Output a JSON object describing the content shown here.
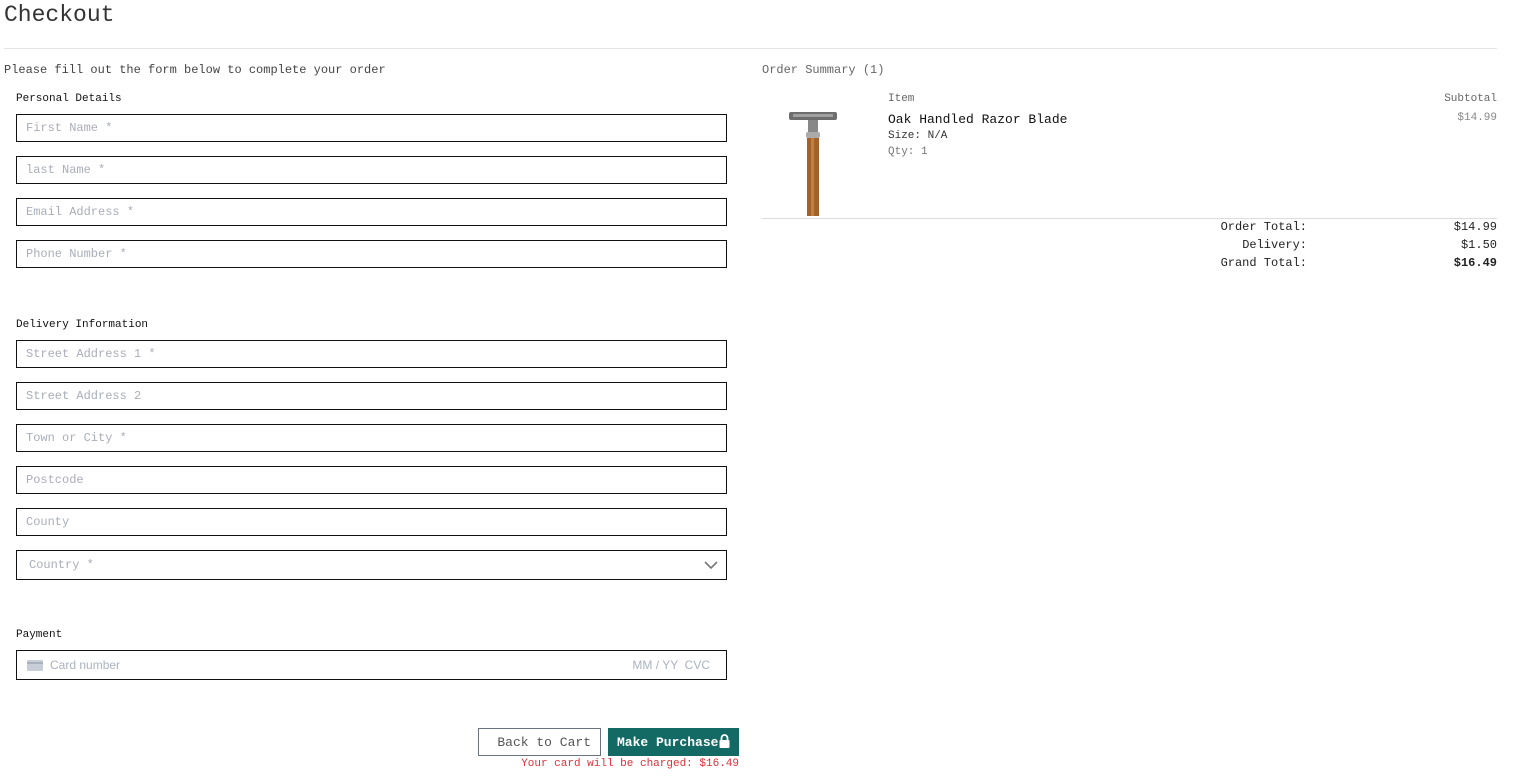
{
  "page": {
    "title": "Checkout",
    "intro": "Please fill out the form below to complete your order"
  },
  "personal": {
    "heading": "Personal Details",
    "fields": [
      {
        "placeholder": "First Name *",
        "value": ""
      },
      {
        "placeholder": "last Name *",
        "value": ""
      },
      {
        "placeholder": "Email Address *",
        "value": ""
      },
      {
        "placeholder": "Phone Number *",
        "value": ""
      }
    ]
  },
  "delivery": {
    "heading": "Delivery Information",
    "fields": [
      {
        "placeholder": "Street Address 1 *"
      },
      {
        "placeholder": "Street Address 2"
      },
      {
        "placeholder": "Town or City *"
      },
      {
        "placeholder": "Postcode"
      },
      {
        "placeholder": "County"
      }
    ],
    "country": {
      "selected": "Country *"
    }
  },
  "payment": {
    "heading": "Payment",
    "card_placeholder": "Card number",
    "expiry_cvc": "MM / YY  CVC"
  },
  "actions": {
    "back": "Back to Cart",
    "purchase": "Make Purchase",
    "charged": "Your card will be charged: $16.49"
  },
  "summary": {
    "title": "Order Summary (1)",
    "col_item": "Item",
    "col_subtotal": "Subtotal",
    "items": [
      {
        "name": "Oak Handled Razor Blade",
        "size": "Size: N/A",
        "qty": "Qty: 1",
        "subtotal": "$14.99"
      }
    ],
    "order_total_label": "Order Total:",
    "order_total": "$14.99",
    "delivery_label": "Delivery:",
    "delivery": "$1.50",
    "grand_total_label": "Grand Total:",
    "grand_total": "$16.49"
  },
  "colors": {
    "accent": "#136a65",
    "error": "#e0303a"
  }
}
